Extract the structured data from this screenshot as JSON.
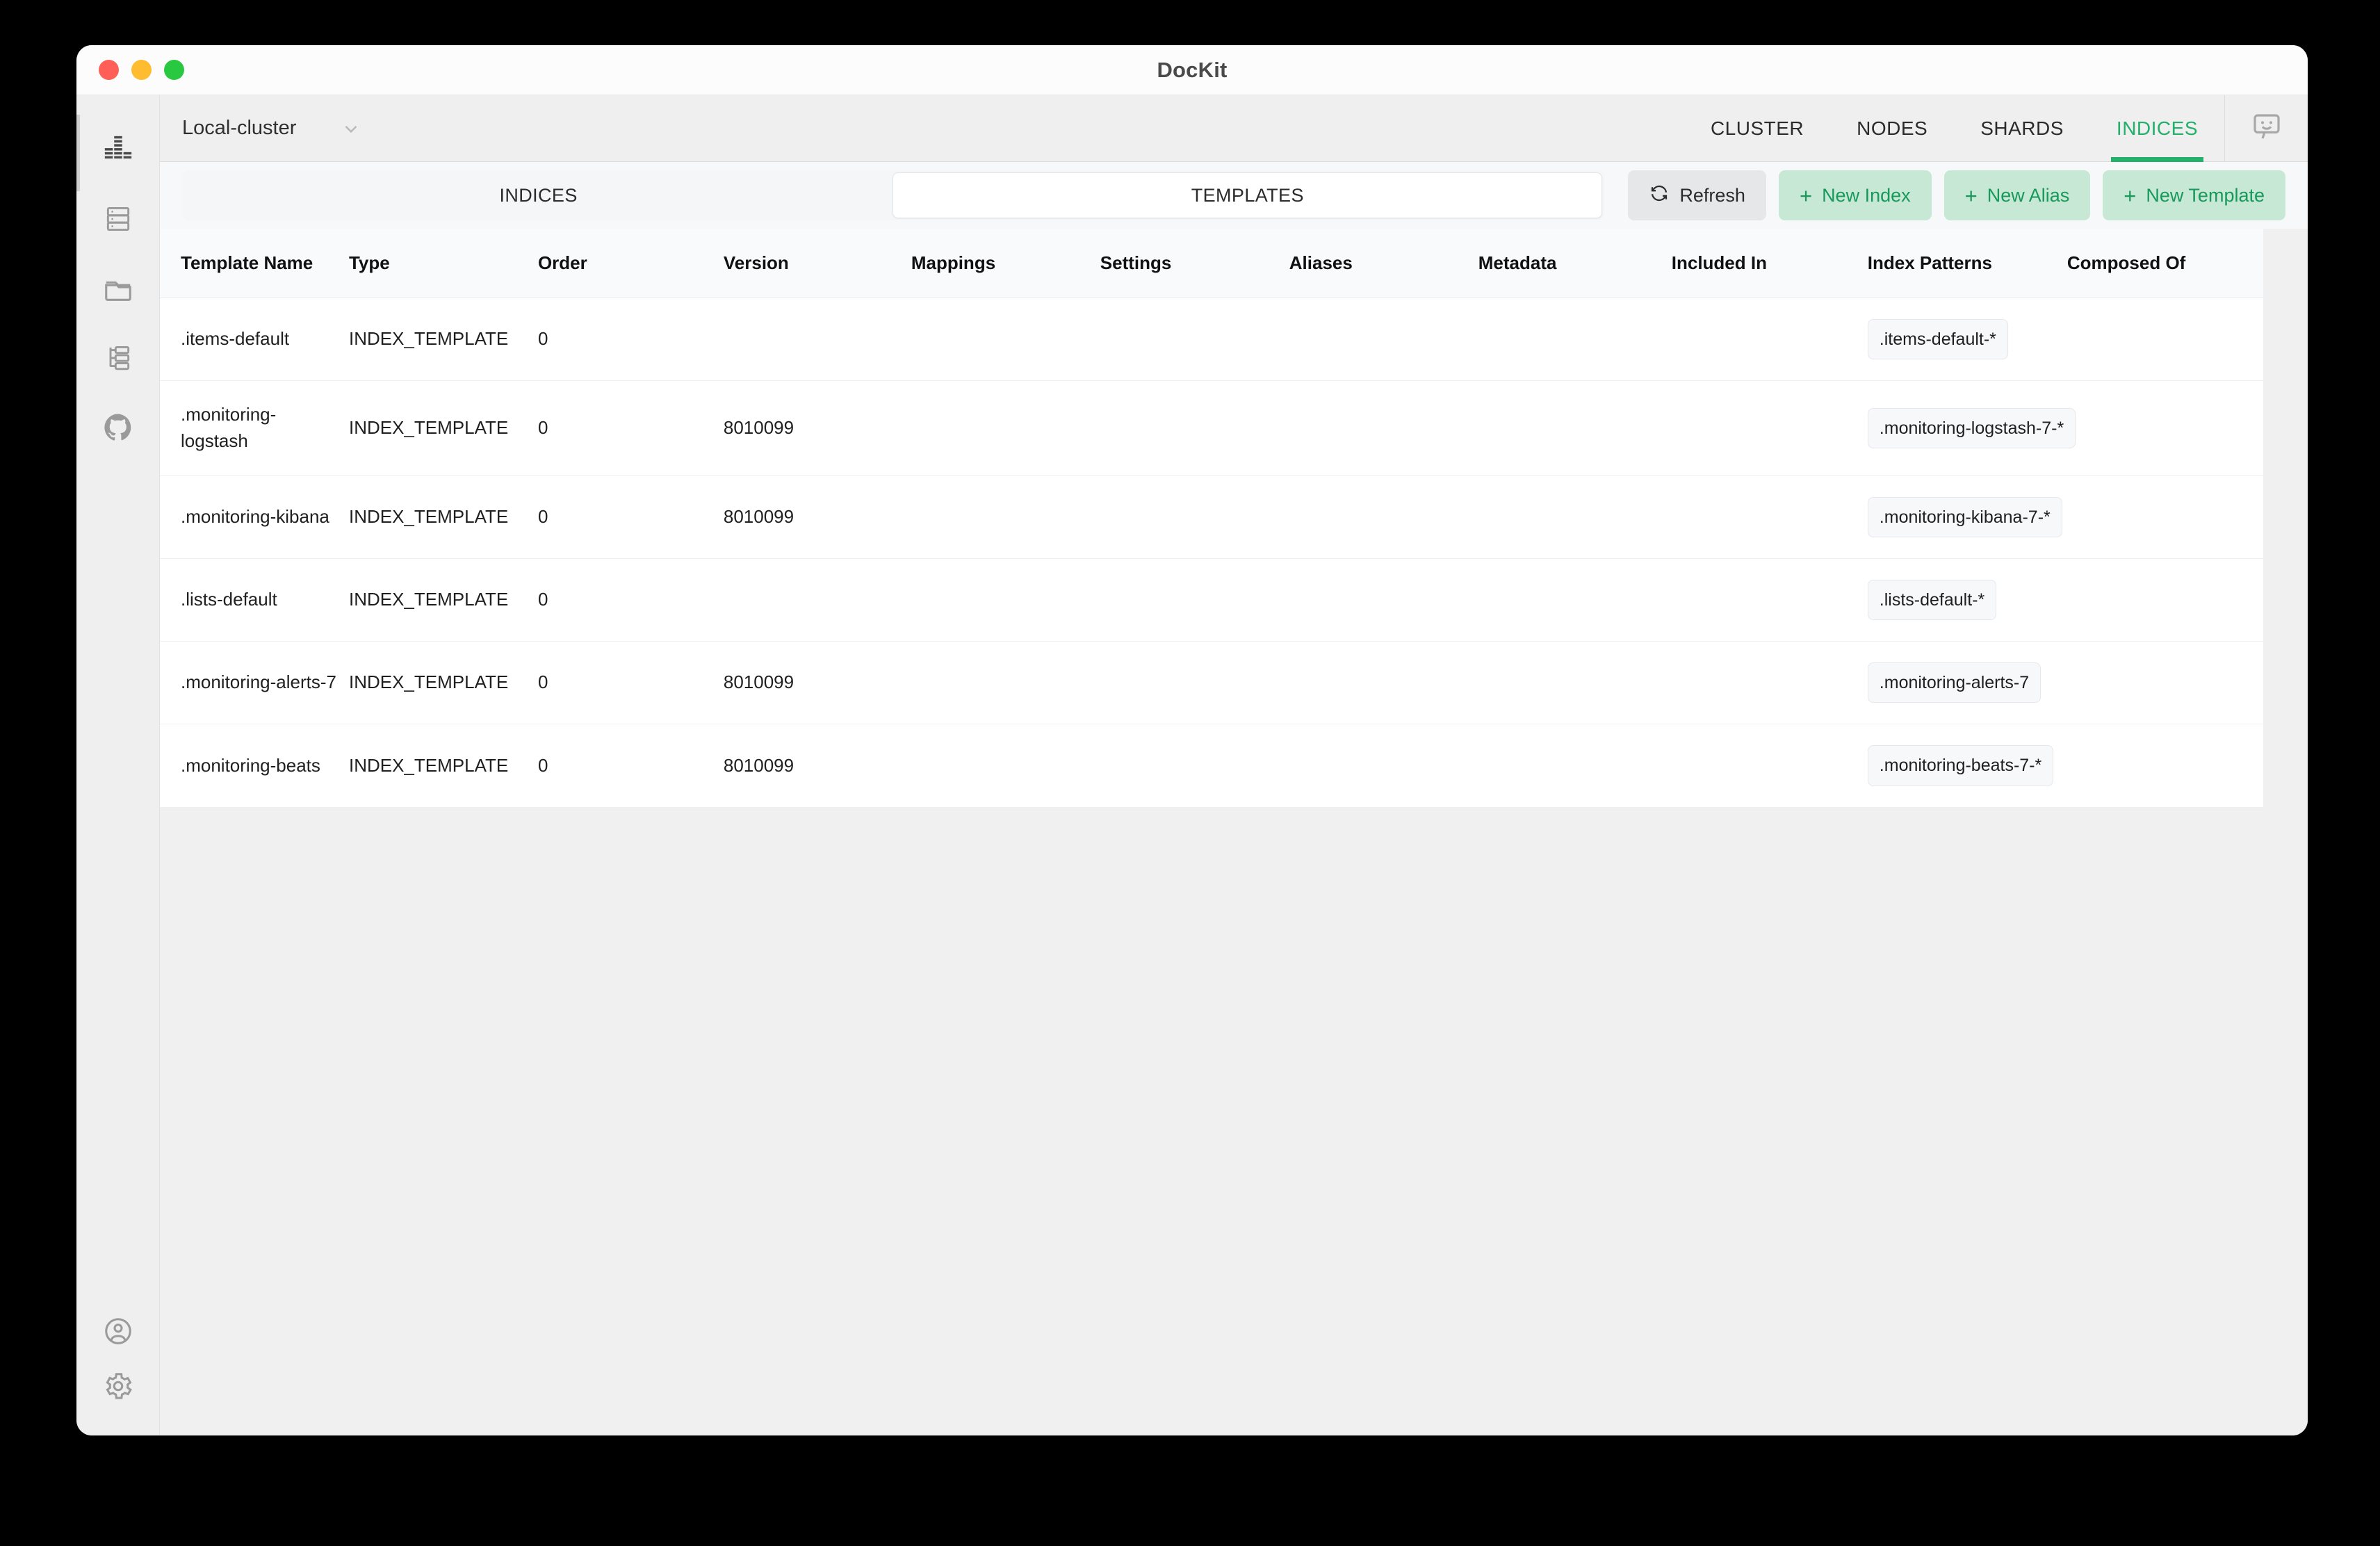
{
  "window": {
    "title": "DocKit",
    "traffic_lights": [
      "close",
      "minimize",
      "zoom"
    ]
  },
  "sidebar": {
    "items": [
      {
        "icon": "equalizer-icon",
        "name": "sidebar-item-dashboard",
        "active": true
      },
      {
        "icon": "database-icon",
        "name": "sidebar-item-database",
        "active": false
      },
      {
        "icon": "folder-icon",
        "name": "sidebar-item-files",
        "active": false
      },
      {
        "icon": "hierarchy-icon",
        "name": "sidebar-item-structure",
        "active": false
      },
      {
        "icon": "github-icon",
        "name": "sidebar-item-github",
        "active": false
      }
    ],
    "bottom_items": [
      {
        "icon": "user-icon",
        "name": "sidebar-item-account"
      },
      {
        "icon": "gear-icon",
        "name": "sidebar-item-settings"
      }
    ]
  },
  "topbar": {
    "cluster_name": "Local-cluster",
    "cluster_chevron": "chevron-down-icon",
    "nav_tabs": [
      {
        "label": "CLUSTER",
        "active": false
      },
      {
        "label": "NODES",
        "active": false
      },
      {
        "label": "SHARDS",
        "active": false
      },
      {
        "label": "INDICES",
        "active": true
      }
    ],
    "feedback_icon": "chat-smiley-icon",
    "accent_color": "#22b06b"
  },
  "segments": [
    {
      "label": "INDICES",
      "active": false
    },
    {
      "label": "TEMPLATES",
      "active": true
    }
  ],
  "actions": [
    {
      "label": "Refresh",
      "icon": "refresh-icon",
      "style": "grey"
    },
    {
      "label": "New Index",
      "icon": "plus-icon",
      "style": "green"
    },
    {
      "label": "New Alias",
      "icon": "plus-icon",
      "style": "green"
    },
    {
      "label": "New Template",
      "icon": "plus-icon",
      "style": "green"
    }
  ],
  "table": {
    "columns": [
      "Template Name",
      "Type",
      "Order",
      "Version",
      "Mappings",
      "Settings",
      "Aliases",
      "Metadata",
      "Included In",
      "Index Patterns",
      "Composed Of"
    ],
    "rows": [
      {
        "template_name": ".items-default",
        "type": "INDEX_TEMPLATE",
        "order": "0",
        "version": "",
        "mappings": "",
        "settings": "",
        "aliases": "",
        "metadata": "",
        "included_in": "",
        "index_patterns": ".items-default-*",
        "composed_of": ""
      },
      {
        "template_name": ".monitoring-logstash",
        "type": "INDEX_TEMPLATE",
        "order": "0",
        "version": "8010099",
        "mappings": "",
        "settings": "",
        "aliases": "",
        "metadata": "",
        "included_in": "",
        "index_patterns": ".monitoring-logstash-7-*",
        "composed_of": ""
      },
      {
        "template_name": ".monitoring-kibana",
        "type": "INDEX_TEMPLATE",
        "order": "0",
        "version": "8010099",
        "mappings": "",
        "settings": "",
        "aliases": "",
        "metadata": "",
        "included_in": "",
        "index_patterns": ".monitoring-kibana-7-*",
        "composed_of": ""
      },
      {
        "template_name": ".lists-default",
        "type": "INDEX_TEMPLATE",
        "order": "0",
        "version": "",
        "mappings": "",
        "settings": "",
        "aliases": "",
        "metadata": "",
        "included_in": "",
        "index_patterns": ".lists-default-*",
        "composed_of": ""
      },
      {
        "template_name": ".monitoring-alerts-7",
        "type": "INDEX_TEMPLATE",
        "order": "0",
        "version": "8010099",
        "mappings": "",
        "settings": "",
        "aliases": "",
        "metadata": "",
        "included_in": "",
        "index_patterns": ".monitoring-alerts-7",
        "composed_of": ""
      },
      {
        "template_name": ".monitoring-beats",
        "type": "INDEX_TEMPLATE",
        "order": "0",
        "version": "8010099",
        "mappings": "",
        "settings": "",
        "aliases": "",
        "metadata": "",
        "included_in": "",
        "index_patterns": ".monitoring-beats-7-*",
        "composed_of": ""
      }
    ]
  }
}
